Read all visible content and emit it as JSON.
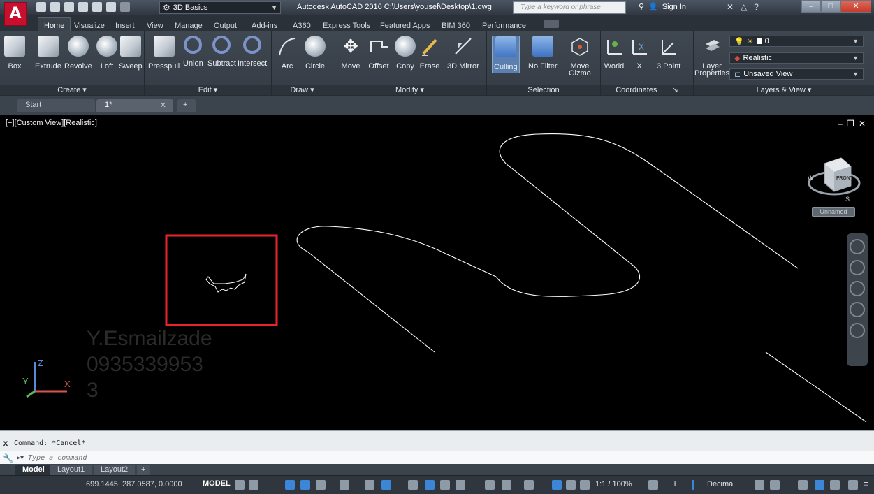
{
  "titlebar": {
    "workspace": "3D Basics",
    "app_title": "Autodesk AutoCAD 2016   C:\\Users\\yousef\\Desktop\\1.dwg",
    "search_placeholder": "Type a keyword or phrase",
    "signin": "Sign In"
  },
  "ribbon_tabs": [
    "Home",
    "Visualize",
    "Insert",
    "View",
    "Manage",
    "Output",
    "Add-ins",
    "A360",
    "Express Tools",
    "Featured Apps",
    "BIM 360",
    "Performance"
  ],
  "ribbon": {
    "create": [
      "Box",
      "Extrude",
      "Revolve",
      "Loft",
      "Sweep"
    ],
    "edit": [
      "Presspull",
      "Union",
      "Subtract",
      "Intersect"
    ],
    "draw": [
      "Arc",
      "Circle"
    ],
    "modify": [
      "Move",
      "Offset",
      "Copy",
      "Erase",
      "3D Mirror"
    ],
    "selection": [
      "Culling",
      "No Filter",
      "Move",
      "Gizmo"
    ],
    "coordinates": [
      "World",
      "X",
      "3 Point"
    ],
    "layers": [
      "Layer",
      "Properties"
    ],
    "layer_value": "0",
    "visual_style": "Realistic",
    "view_value": "Unsaved View",
    "panel_labels": {
      "create": "Create",
      "edit": "Edit",
      "draw": "Draw",
      "modify": "Modify",
      "selection": "Selection",
      "coordinates": "Coordinates",
      "layers_view": "Layers & View"
    }
  },
  "doc_tabs": [
    "Start",
    "1*"
  ],
  "viewport": {
    "label": "[−][Custom View][Realistic]",
    "view_name": "Unnamed",
    "cube_face": "FRONT",
    "watermark": [
      "Y.Esmailzade",
      "0935339953",
      "3"
    ]
  },
  "command": {
    "history": "Command: *Cancel*",
    "placeholder": "Type a command"
  },
  "layout_tabs": [
    "Model",
    "Layout1",
    "Layout2"
  ],
  "status": {
    "coords": "699.1445, 287.0587, 0.0000",
    "model": "MODEL",
    "scale": "1:1 / 100%",
    "units": "Decimal"
  },
  "colors": {
    "highlight_box": "#e8252a",
    "app_red": "#c8102e",
    "drawing_line": "#ffffff"
  }
}
